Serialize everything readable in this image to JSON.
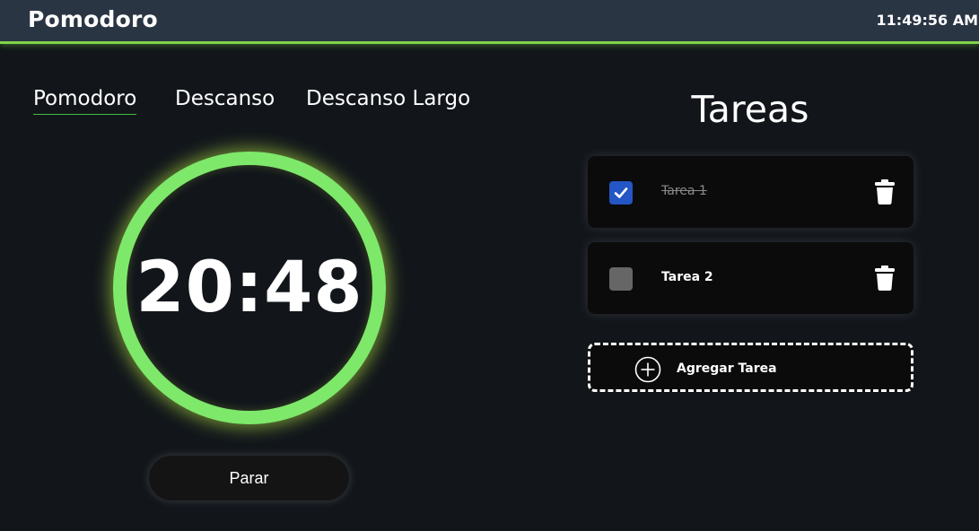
{
  "header": {
    "title": "Pomodoro",
    "clock": "11:49:56 AM"
  },
  "tabs": [
    {
      "label": "Pomodoro",
      "active": true
    },
    {
      "label": "Descanso",
      "active": false
    },
    {
      "label": "Descanso Largo",
      "active": false
    }
  ],
  "timer": {
    "display": "20:48",
    "ring_color": "#7ee86a"
  },
  "controls": {
    "stop_label": "Parar"
  },
  "tasks": {
    "title": "Tareas",
    "items": [
      {
        "label": "Tarea 1",
        "done": true,
        "delete_icon": "trash-icon"
      },
      {
        "label": "Tarea 2",
        "done": false,
        "delete_icon": "trash-icon"
      }
    ],
    "add_label": "Agregar Tarea",
    "add_icon": "plus-circle-icon"
  },
  "colors": {
    "accent": "#7fd44a",
    "checkbox_checked": "#2457c5",
    "checkbox_unchecked": "#666666",
    "header_bg": "#2a3544"
  }
}
